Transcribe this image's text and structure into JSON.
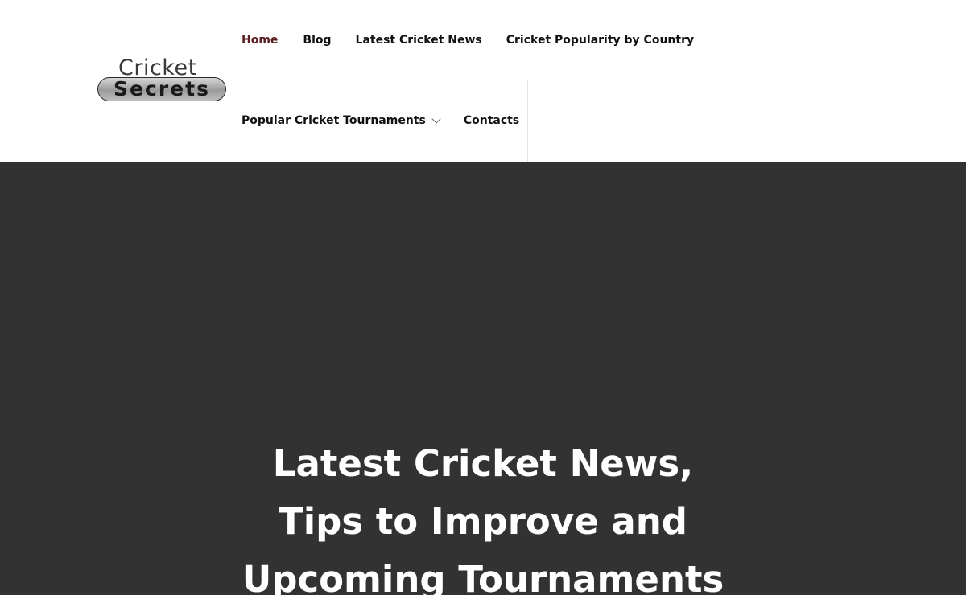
{
  "logo": {
    "top_text": "Cricket",
    "bottom_text": "Secrets"
  },
  "nav": {
    "row1": [
      {
        "label": "Home",
        "active": true
      },
      {
        "label": "Blog"
      },
      {
        "label": "Latest Cricket News"
      },
      {
        "label": "Cricket Popularity by Country"
      }
    ],
    "row2": [
      {
        "label": "Popular Cricket Tournaments",
        "has_dropdown": true,
        "icon": "chevron-down-icon"
      },
      {
        "label": "Contacts"
      }
    ]
  },
  "hero": {
    "title_lines": [
      "Latest Cricket News,",
      "Tips to Improve and",
      "Upcoming Tournaments"
    ]
  },
  "colors": {
    "active_link": "#5a1e1e",
    "hero_background": "#323232",
    "hero_text": "#ffffff"
  }
}
